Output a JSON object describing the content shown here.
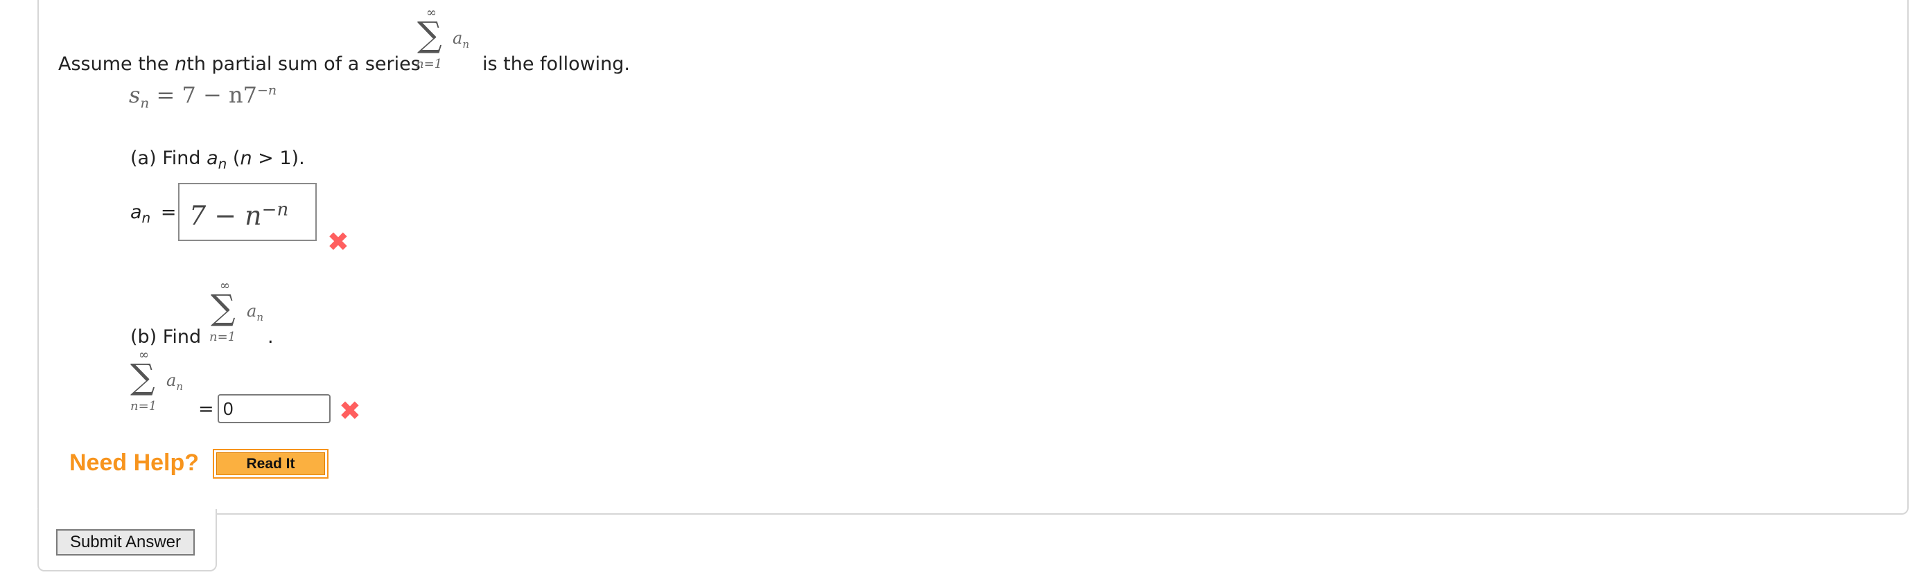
{
  "question": {
    "intro_prefix": "Assume the ",
    "intro_n": "n",
    "intro_mid": "th partial sum of a series",
    "intro_suffix": "is the following.",
    "sigma_sum": {
      "upper": "∞",
      "symbol": "∑",
      "term": "a",
      "term_sub": "n",
      "lower": "n=1"
    },
    "formula": {
      "lhs": "s",
      "lhs_sub": "n",
      "eq": "= 7 − n7",
      "exp": "−n"
    }
  },
  "part_a": {
    "prefix": "(a) Find ",
    "var": "a",
    "var_sub": "n",
    "cond_open": " (",
    "cond_n": "n",
    "cond_close": " > 1).",
    "answer_label": "a",
    "answer_label_sub": "n",
    "answer_eq": "=",
    "answer_base": "7 − n",
    "answer_exp": "−n",
    "status_icon": "incorrect-x-icon",
    "status_color": "#ff5f5f"
  },
  "part_b": {
    "prefix": "(b) Find",
    "period": ".",
    "answer_eq": "=",
    "answer_value": "0",
    "status_icon": "incorrect-x-icon"
  },
  "help": {
    "label": "Need Help?",
    "read_it_label": "Read It",
    "accent": "#f7941d"
  },
  "submit": {
    "label": "Submit Answer"
  }
}
